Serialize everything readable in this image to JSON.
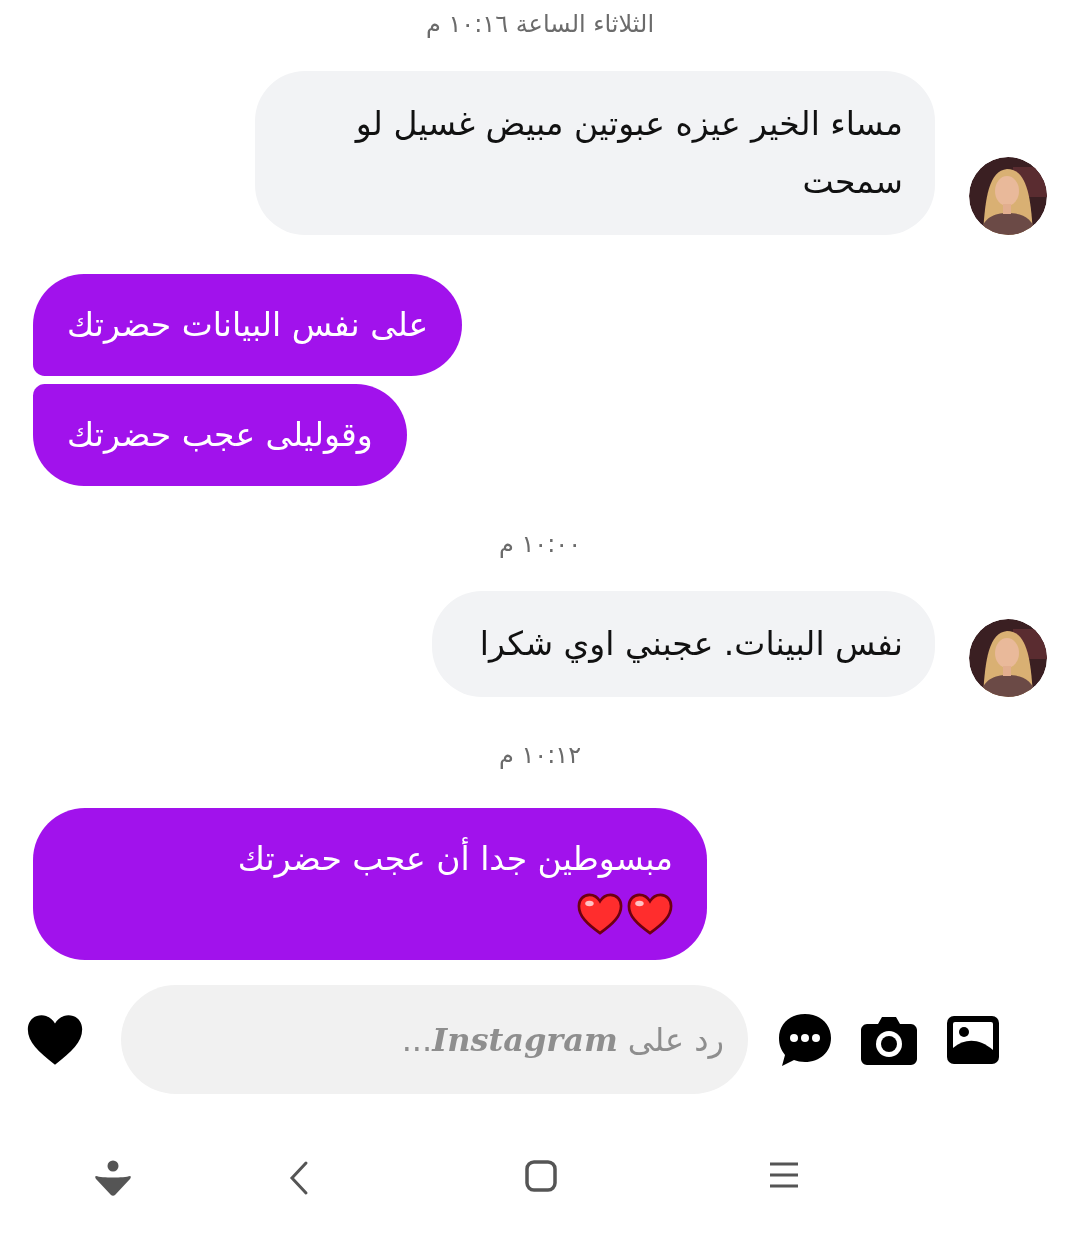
{
  "messages": [
    {
      "kind": "timestamp",
      "text": "الثلاثاء الساعة ١٠:١٦ م"
    },
    {
      "kind": "incoming",
      "text": "مساء الخير عيزه عبوتين مبيض غسيل لو سمحت"
    },
    {
      "kind": "outgoing",
      "text": "على نفس البيانات حضرتك"
    },
    {
      "kind": "outgoing",
      "text": "وقوليلى عجب حضرتك"
    },
    {
      "kind": "timestamp",
      "text": "١٠:٠٠ م"
    },
    {
      "kind": "incoming",
      "text": "نفس البينات. عجبني اوي شكرا"
    },
    {
      "kind": "timestamp",
      "text": "١٠:١٢ م"
    },
    {
      "kind": "hearted",
      "text": "مبسوطين جدا أن عجب حضرتك"
    }
  ],
  "composer": {
    "placeholder": "رد على **Instagram**..."
  }
}
